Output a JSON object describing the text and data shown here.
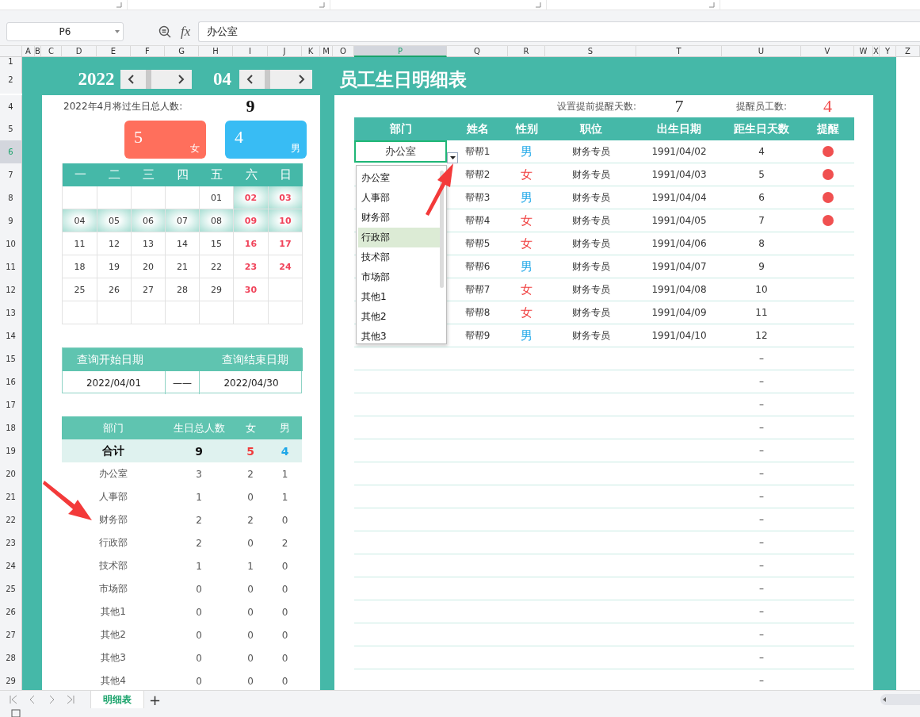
{
  "formula_bar": {
    "name_box": "P6",
    "fx_label": "fx",
    "formula": "办公室"
  },
  "columns": [
    {
      "label": "A",
      "selected": false
    },
    {
      "label": "B",
      "selected": false
    },
    {
      "label": "C",
      "selected": false
    },
    {
      "label": "D",
      "selected": false
    },
    {
      "label": "E",
      "selected": false
    },
    {
      "label": "F",
      "selected": false
    },
    {
      "label": "G",
      "selected": false
    },
    {
      "label": "H",
      "selected": false
    },
    {
      "label": "I",
      "selected": false
    },
    {
      "label": "J",
      "selected": false
    },
    {
      "label": "K",
      "selected": false
    },
    {
      "label": "M",
      "selected": false
    },
    {
      "label": "O",
      "selected": false
    },
    {
      "label": "P",
      "selected": true
    },
    {
      "label": "Q",
      "selected": false
    },
    {
      "label": "R",
      "selected": false
    },
    {
      "label": "S",
      "selected": false
    },
    {
      "label": "T",
      "selected": false
    },
    {
      "label": "U",
      "selected": false
    },
    {
      "label": "V",
      "selected": false
    },
    {
      "label": "W",
      "selected": false
    },
    {
      "label": "X",
      "selected": false
    },
    {
      "label": "Y",
      "selected": false
    },
    {
      "label": "Z",
      "selected": false
    }
  ],
  "row_numbers": [
    {
      "label": "1",
      "selected": false
    },
    {
      "label": "2",
      "selected": false
    },
    {
      "label": "4",
      "selected": false
    },
    {
      "label": "5",
      "selected": false
    },
    {
      "label": "6",
      "selected": true
    },
    {
      "label": "7",
      "selected": false
    },
    {
      "label": "8",
      "selected": false
    },
    {
      "label": "9",
      "selected": false
    },
    {
      "label": "10",
      "selected": false
    },
    {
      "label": "11",
      "selected": false
    },
    {
      "label": "12",
      "selected": false
    },
    {
      "label": "13",
      "selected": false
    },
    {
      "label": "14",
      "selected": false
    },
    {
      "label": "15",
      "selected": false
    },
    {
      "label": "16",
      "selected": false
    },
    {
      "label": "17",
      "selected": false
    },
    {
      "label": "18",
      "selected": false
    },
    {
      "label": "19",
      "selected": false
    },
    {
      "label": "20",
      "selected": false
    },
    {
      "label": "21",
      "selected": false
    },
    {
      "label": "22",
      "selected": false
    },
    {
      "label": "23",
      "selected": false
    },
    {
      "label": "24",
      "selected": false
    },
    {
      "label": "25",
      "selected": false
    },
    {
      "label": "26",
      "selected": false
    },
    {
      "label": "27",
      "selected": false
    },
    {
      "label": "28",
      "selected": false
    },
    {
      "label": "29",
      "selected": false
    }
  ],
  "header": {
    "year": "2022",
    "month": "04",
    "title": "员工生日明细表"
  },
  "summary": {
    "label": "2022年4月将过生日总人数:",
    "total": "9",
    "female_count": "5",
    "female_label": "女",
    "male_count": "4",
    "male_label": "男"
  },
  "calendar": {
    "weekdays": [
      "一",
      "二",
      "三",
      "四",
      "五",
      "六",
      "日"
    ],
    "weeks": [
      [
        {
          "highlighted": false
        },
        {
          "highlighted": false
        },
        {
          "highlighted": false
        },
        {
          "highlighted": false
        },
        {
          "day": "01",
          "highlighted": false
        },
        {
          "day": "02",
          "highlighted": true
        },
        {
          "day": "03",
          "highlighted": true
        }
      ],
      [
        {
          "day": "04",
          "highlighted": true
        },
        {
          "day": "05",
          "highlighted": true
        },
        {
          "day": "06",
          "highlighted": true
        },
        {
          "day": "07",
          "highlighted": true
        },
        {
          "day": "08",
          "highlighted": true
        },
        {
          "day": "09",
          "highlighted": true
        },
        {
          "day": "10",
          "highlighted": true
        }
      ],
      [
        {
          "day": "11",
          "highlighted": false
        },
        {
          "day": "12",
          "highlighted": false
        },
        {
          "day": "13",
          "highlighted": false
        },
        {
          "day": "14",
          "highlighted": false
        },
        {
          "day": "15",
          "highlighted": false
        },
        {
          "day": "16",
          "highlighted": false
        },
        {
          "day": "17",
          "highlighted": false
        }
      ],
      [
        {
          "day": "18",
          "highlighted": false
        },
        {
          "day": "19",
          "highlighted": false
        },
        {
          "day": "20",
          "highlighted": false
        },
        {
          "day": "21",
          "highlighted": false
        },
        {
          "day": "22",
          "highlighted": false
        },
        {
          "day": "23",
          "highlighted": false
        },
        {
          "day": "24",
          "highlighted": false
        }
      ],
      [
        {
          "day": "25",
          "highlighted": false
        },
        {
          "day": "26",
          "highlighted": false
        },
        {
          "day": "27",
          "highlighted": false
        },
        {
          "day": "28",
          "highlighted": false
        },
        {
          "day": "29",
          "highlighted": false
        },
        {
          "day": "30",
          "highlighted": false
        },
        {
          "highlighted": false
        }
      ],
      [
        {
          "highlighted": false
        },
        {
          "highlighted": false
        },
        {
          "highlighted": false
        },
        {
          "highlighted": false
        },
        {
          "highlighted": false
        },
        {
          "highlighted": false
        },
        {
          "highlighted": false
        }
      ]
    ]
  },
  "query": {
    "start_label": "查询开始日期",
    "end_label": "查询结束日期",
    "start": "2022/04/01",
    "separator": "——",
    "end": "2022/04/30"
  },
  "department_table": {
    "columns": [
      "部门",
      "生日总人数",
      "女",
      "男"
    ],
    "total": {
      "dept": "合计",
      "total": "9",
      "female": "5",
      "male": "4"
    },
    "rows": [
      {
        "dept": "办公室",
        "total": "3",
        "female": "2",
        "male": "1"
      },
      {
        "dept": "人事部",
        "total": "1",
        "female": "0",
        "male": "1"
      },
      {
        "dept": "财务部",
        "total": "2",
        "female": "2",
        "male": "0"
      },
      {
        "dept": "行政部",
        "total": "2",
        "female": "0",
        "male": "2"
      },
      {
        "dept": "技术部",
        "total": "1",
        "female": "1",
        "male": "0"
      },
      {
        "dept": "市场部",
        "total": "0",
        "female": "0",
        "male": "0"
      },
      {
        "dept": "其他1",
        "total": "0",
        "female": "0",
        "male": "0"
      },
      {
        "dept": "其他2",
        "total": "0",
        "female": "0",
        "male": "0"
      },
      {
        "dept": "其他3",
        "total": "0",
        "female": "0",
        "male": "0"
      },
      {
        "dept": "其他4",
        "total": "0",
        "female": "0",
        "male": "0"
      }
    ]
  },
  "reminder": {
    "days_label": "设置提前提醒天数:",
    "days": "7",
    "count_label": "提醒员工数:",
    "count": "4"
  },
  "employee_table": {
    "columns": [
      "部门",
      "姓名",
      "性别",
      "职位",
      "出生日期",
      "距生日天数",
      "提醒"
    ],
    "rows": [
      {
        "dept": "办公室",
        "name": "帮帮1",
        "gender": "男",
        "color": "#1ea7e8",
        "position": "财务专员",
        "birth": "1991/04/02",
        "days": "4",
        "remind": true
      },
      {
        "name": "帮帮2",
        "gender": "女",
        "color": "#f03c3c",
        "position": "财务专员",
        "birth": "1991/04/03",
        "days": "5",
        "remind": true
      },
      {
        "name": "帮帮3",
        "gender": "男",
        "color": "#1ea7e8",
        "position": "财务专员",
        "birth": "1991/04/04",
        "days": "6",
        "remind": true
      },
      {
        "name": "帮帮4",
        "gender": "女",
        "color": "#f03c3c",
        "position": "财务专员",
        "birth": "1991/04/05",
        "days": "7",
        "remind": true
      },
      {
        "name": "帮帮5",
        "gender": "女",
        "color": "#f03c3c",
        "position": "财务专员",
        "birth": "1991/04/06",
        "days": "8",
        "remind": false
      },
      {
        "name": "帮帮6",
        "gender": "男",
        "color": "#1ea7e8",
        "position": "财务专员",
        "birth": "1991/04/07",
        "days": "9",
        "remind": false
      },
      {
        "name": "帮帮7",
        "gender": "女",
        "color": "#f03c3c",
        "position": "财务专员",
        "birth": "1991/04/08",
        "days": "10",
        "remind": false
      },
      {
        "name": "帮帮8",
        "gender": "女",
        "color": "#f03c3c",
        "position": "财务专员",
        "birth": "1991/04/09",
        "days": "11",
        "remind": false
      },
      {
        "name": "帮帮9",
        "gender": "男",
        "color": "#1ea7e8",
        "position": "财务专员",
        "birth": "1991/04/10",
        "days": "12",
        "remind": false
      },
      {
        "days": "–"
      },
      {
        "days": "–"
      },
      {
        "days": "–"
      },
      {
        "days": "–"
      },
      {
        "days": "–"
      },
      {
        "days": "–"
      },
      {
        "days": "–"
      },
      {
        "days": "–"
      },
      {
        "days": "–"
      },
      {
        "days": "–"
      },
      {
        "days": "–"
      },
      {
        "days": "–"
      },
      {
        "days": "–"
      },
      {
        "days": "–"
      },
      {
        "days": "–"
      }
    ]
  },
  "dropdown": {
    "items": [
      {
        "label": "办公室",
        "selected": false
      },
      {
        "label": "人事部",
        "selected": false
      },
      {
        "label": "财务部",
        "selected": false
      },
      {
        "label": "行政部",
        "selected": true
      },
      {
        "label": "技术部",
        "selected": false
      },
      {
        "label": "市场部",
        "selected": false
      },
      {
        "label": "其他1",
        "selected": false
      },
      {
        "label": "其他2",
        "selected": false
      },
      {
        "label": "其他3",
        "selected": false
      }
    ]
  },
  "sheet_tabs": [
    {
      "label": "明细表",
      "selected": true
    }
  ],
  "add_sheet": "+"
}
